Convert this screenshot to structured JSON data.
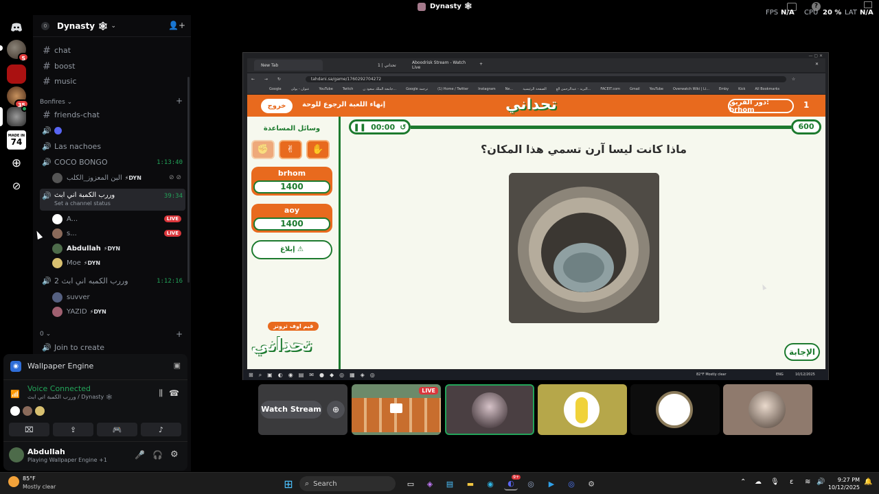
{
  "topbar": {
    "title": "Dynasty 🕸",
    "fps_label": "FPS",
    "fps_value": "N/A",
    "cpu_label": "CPU",
    "cpu_value": "20 %",
    "lat_label": "LAT",
    "lat_value": "N/A"
  },
  "rail": {
    "badges": [
      "5",
      "35"
    ],
    "made_in_label": "MADE IN",
    "made_in_value": "74"
  },
  "guild": {
    "name": "Dynasty 🕸",
    "boost_level": "0"
  },
  "channels": {
    "top": [
      {
        "name": "chat"
      },
      {
        "name": "boost"
      },
      {
        "name": "music"
      }
    ],
    "category_bonfires": "Bonfires",
    "friends_chat": "friends-chat",
    "voice_las": "Las nachoes",
    "coco": {
      "name": "COCO BONGO",
      "time": "1:13:40"
    },
    "coco_user": "البن المعزوز_الكلب",
    "wurb": {
      "name": "وررب الكمبة اني ابث",
      "status": "Set a channel status",
      "time": "39:34"
    },
    "wurb_users": [
      {
        "name": "A...",
        "live": "LIVE"
      },
      {
        "name": "s...",
        "live": "LIVE"
      },
      {
        "name": "Abdullah",
        "tag": "DYN"
      },
      {
        "name": "Moe",
        "tag": "DYN"
      }
    ],
    "wurb2": {
      "name": "وررب الكمبه اني ابث 2",
      "time": "1:12:16"
    },
    "wurb2_users": [
      {
        "name": "suvver"
      },
      {
        "name": "YAZID",
        "tag": "DYN"
      }
    ],
    "category_blank": "0",
    "join_create": "Join to create"
  },
  "panel": {
    "activity": "Wallpaper Engine",
    "voice_status": "Voice Connected",
    "voice_channel": "وررب الكمبة اني ابث / Dynasty 🕸",
    "user_name": "Abdullah",
    "user_status": "Playing Wallpaper Engine +1"
  },
  "browser": {
    "tab1": "New Tab",
    "tab2": "تحداني | 1",
    "tab3": "Aboodrisk Stream - Watch Live",
    "url": "tahdani.sa/game/1760292704272",
    "bookmarks": [
      "Google",
      "عنوان - يولى",
      "YouTube",
      "Twitch",
      "جامعة الملك سعود ن...",
      "Google ترجمة",
      "(1) Home / Twitter",
      "Instagram",
      "Ne...",
      "الصفحة الرئيسية",
      "البريد - عبدالرحمن الع...",
      "FACEIT.com",
      "Gmail",
      "YouTube",
      "Overwatch Wiki | Li...",
      "Emby",
      "Kick",
      "All Bookmarks"
    ]
  },
  "game": {
    "exit": "خروج",
    "back": "الرجوع للوحة",
    "end": "إنهاء اللعبة",
    "logo": "تحداني",
    "turn": "دور الفريق: brhom",
    "turn_num": "1",
    "helpers_title": "وسائل المساعدة",
    "team1": {
      "name": "brhom",
      "score": "1400"
    },
    "team2": {
      "name": "aoy",
      "score": "1400"
    },
    "report": "إبلاغ ⚠",
    "game_over_tag": "قيم اوف ثرونز",
    "timer": "00:00",
    "points": "600",
    "question": "ماذا كانت ليسا آرن تسمي هذا المكان؟",
    "answer": "الإجابة"
  },
  "stream_taskbar": {
    "weather": "82°F Mostly clear",
    "lang": "ENG",
    "clock": "10/12/2025"
  },
  "tiles": {
    "watch_label": "Watch Stream",
    "live": "LIVE"
  },
  "taskbar": {
    "weather_temp": "85°F",
    "weather_desc": "Mostly clear",
    "search": "Search",
    "time": "9:27 PM",
    "date": "10/12/2025",
    "discord_badge": "9+"
  }
}
